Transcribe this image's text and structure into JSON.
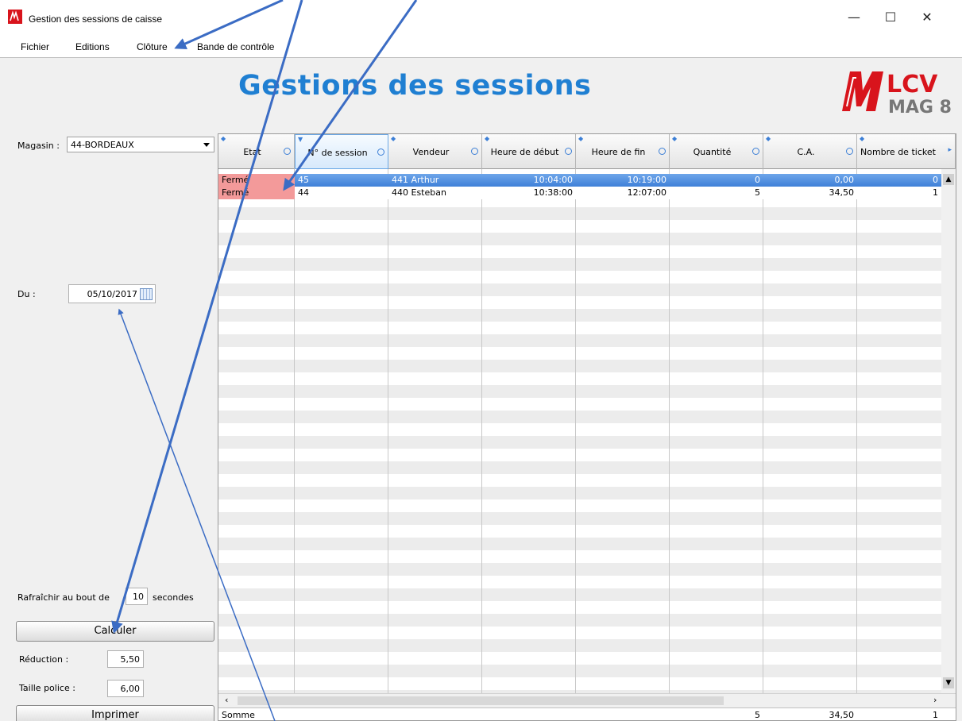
{
  "window": {
    "title": "Gestion des sessions de caisse"
  },
  "menu": {
    "items": [
      "Fichier",
      "Editions",
      "Clôture",
      "Bande de contrôle"
    ]
  },
  "header": {
    "title": "Gestions des sessions",
    "logo_top": "LCV",
    "logo_bottom": "MAG 8"
  },
  "filters": {
    "magasin_label": "Magasin :",
    "magasin_value": "44-BORDEAUX",
    "du_label": "Du :",
    "du_value": "05/10/2017",
    "refresh_prefix": "Rafraîchir au bout de",
    "refresh_value": "10",
    "refresh_suffix": "secondes"
  },
  "actions": {
    "calculer": "Calculer",
    "reduction_label": "Réduction :",
    "reduction_value": "5,50",
    "taille_label": "Taille police :",
    "taille_value": "6,00",
    "imprimer": "Imprimer"
  },
  "table": {
    "columns": [
      "Etat",
      "N° de session",
      "Vendeur",
      "Heure de début",
      "Heure de fin",
      "Quantité",
      "C.A.",
      "Nombre de ticket"
    ],
    "rows": [
      {
        "etat": "Fermé",
        "session": "45",
        "vendeur": "441 Arthur",
        "debut": "10:04:00",
        "fin": "10:19:00",
        "quantite": "0",
        "ca": "0,00",
        "tickets": "0"
      },
      {
        "etat": "Fermé",
        "session": "44",
        "vendeur": "440 Esteban",
        "debut": "10:38:00",
        "fin": "12:07:00",
        "quantite": "5",
        "ca": "34,50",
        "tickets": "1"
      }
    ],
    "footer": {
      "label": "Somme",
      "quantite": "5",
      "ca": "34,50",
      "tickets": "1"
    }
  },
  "colors": {
    "title_blue": "#1f7fd2",
    "selection_blue": "#4f8fe0",
    "closed_red": "#f39a9a",
    "annotation_arrow": "#3b6cc4",
    "logo_red": "#d8141c"
  }
}
